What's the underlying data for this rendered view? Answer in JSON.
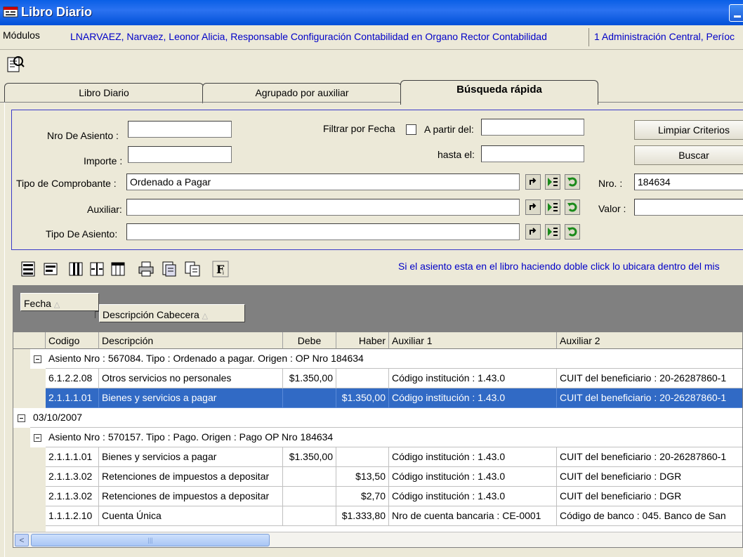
{
  "window": {
    "title": "Libro Diario"
  },
  "infobar": {
    "modulos": "Módulos",
    "user": "LNARVAEZ, Narvaez, Leonor Alicia, Responsable Configuración Contabilidad en Organo Rector Contabilidad",
    "org": "1 Administración Central, Períoc"
  },
  "tabs": [
    {
      "label": "Libro Diario",
      "active": false
    },
    {
      "label": "Agrupado por auxiliar",
      "active": false
    },
    {
      "label": "Búsqueda rápida",
      "active": true
    }
  ],
  "criteria": {
    "nro_asiento_label": "Nro De Asiento :",
    "nro_asiento_value": "",
    "importe_label": "Importe :",
    "importe_value": "",
    "filtrar_fecha_label": "Filtrar por Fecha",
    "filtrar_fecha_checked": false,
    "a_partir_label": "A partir del:",
    "a_partir_value": "",
    "hasta_label": "hasta el:",
    "hasta_value": "",
    "tipo_comprobante_label": "Tipo de Comprobante :",
    "tipo_comprobante_value": "Ordenado  a  Pagar",
    "auxiliar_label": "Auxiliar:",
    "auxiliar_value": "",
    "tipo_asiento_label": "Tipo De Asiento:",
    "tipo_asiento_value": "",
    "nro_label": "Nro. :",
    "nro_value": "184634",
    "valor_label": "Valor :",
    "valor_value": "",
    "limpiar_label": "Limpiar Criterios",
    "buscar_label": "Buscar"
  },
  "hint": "Si el asiento esta en el libro haciendo doble click lo ubicara dentro del mis",
  "grid": {
    "group_chips": [
      "Fecha",
      "Descripción Cabecera"
    ],
    "sort_arrow": "△",
    "columns": [
      "Codigo",
      "Descripción",
      "Debe",
      "Haber",
      "Auxiliar 1",
      "Auxiliar 2"
    ],
    "groups": [
      {
        "header": "Asiento Nro : 567084. Tipo : Ordenado a pagar. Origen : OP Nro 184634",
        "rows": [
          {
            "codigo": "6.1.2.2.08",
            "descripcion": "Otros servicios no personales",
            "debe": "$1.350,00",
            "haber": "",
            "aux1": "Código institución  : 1.43.0",
            "aux2": "CUIT del beneficiario : 20-26287860-1",
            "selected": false
          },
          {
            "codigo": "2.1.1.1.01",
            "descripcion": "Bienes y servicios a pagar",
            "debe": "",
            "haber": "$1.350,00",
            "aux1": "Código institución  : 1.43.0",
            "aux2": "CUIT del beneficiario : 20-26287860-1",
            "selected": true
          }
        ]
      }
    ],
    "date_group": "03/10/2007",
    "groups2": [
      {
        "header": "Asiento Nro : 570157. Tipo : Pago. Origen : Pago OP Nro  184634",
        "rows": [
          {
            "codigo": "2.1.1.1.01",
            "descripcion": "Bienes y servicios a pagar",
            "debe": "$1.350,00",
            "haber": "",
            "aux1": "Código institución  : 1.43.0",
            "aux2": "CUIT del beneficiario : 20-26287860-1",
            "selected": false
          },
          {
            "codigo": "2.1.1.3.02",
            "descripcion": "Retenciones de impuestos a depositar",
            "debe": "",
            "haber": "$13,50",
            "aux1": "Código institución  : 1.43.0",
            "aux2": "CUIT del beneficiario : DGR",
            "selected": false
          },
          {
            "codigo": "2.1.1.3.02",
            "descripcion": "Retenciones de impuestos a depositar",
            "debe": "",
            "haber": "$2,70",
            "aux1": "Código institución  : 1.43.0",
            "aux2": "CUIT del beneficiario : DGR",
            "selected": false
          },
          {
            "codigo": "1.1.1.2.10",
            "descripcion": "Cuenta Única",
            "debe": "",
            "haber": "$1.333,80",
            "aux1": "Nro de cuenta bancaria : CE-0001",
            "aux2": "Código de banco : 045. Banco de San",
            "selected": false
          }
        ]
      }
    ],
    "scroll_left_glyph": "<",
    "scroll_thumb_glyph": "|||"
  }
}
